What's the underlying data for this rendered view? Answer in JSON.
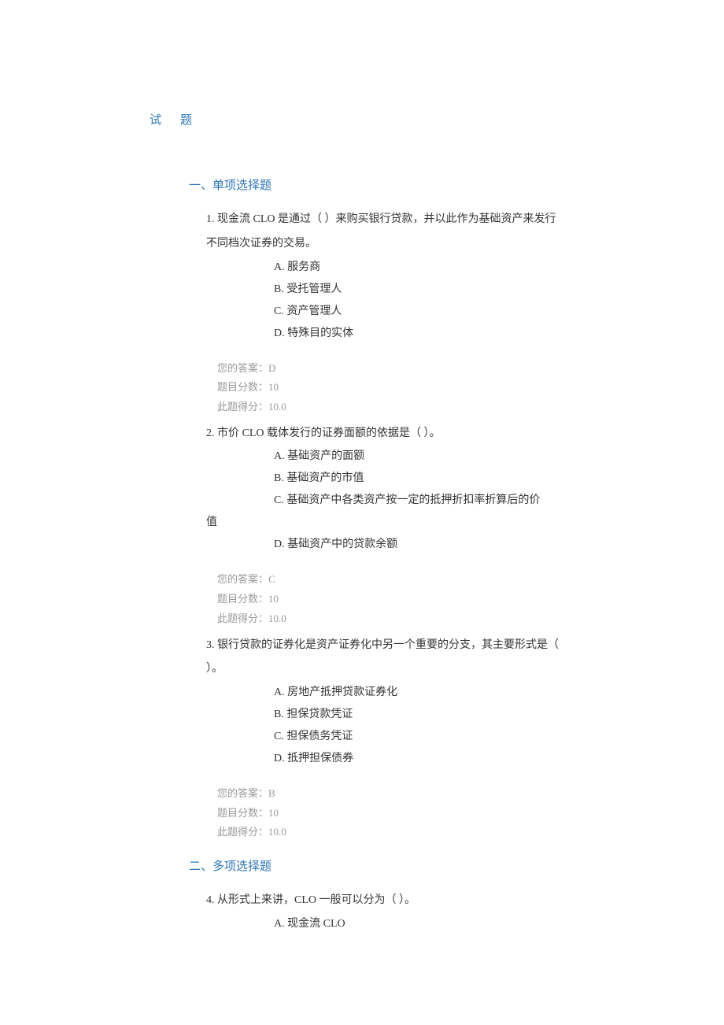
{
  "title": "试题",
  "section1": {
    "heading": "一、单项选择题",
    "questions": [
      {
        "stem": "1. 现金流 CLO 是通过（ ）来购买银行贷款，并以此作为基础资产来发行不同档次证券的交易。",
        "optA": "A. 服务商",
        "optB": "B. 受托管理人",
        "optC": "C. 资产管理人",
        "optD": "D. 特殊目的实体",
        "your_answer": "您的答案：D",
        "points": "题目分数：10",
        "score": "此题得分：10.0"
      },
      {
        "stem": "2. 市价 CLO 载体发行的证券面额的依据是（ ）。",
        "optA": "A. 基础资产的面额",
        "optB": "B. 基础资产的市值",
        "optC_pre": "C. 基础资产中各类资产按一定的抵押折扣率折算后的价",
        "optC_wrap": "值",
        "optD": "D. 基础资产中的贷款余额",
        "your_answer": "您的答案：C",
        "points": "题目分数：10",
        "score": "此题得分：10.0"
      },
      {
        "stem": "3. 银行贷款的证券化是资产证券化中另一个重要的分支，其主要形式是（ ）。",
        "optA": "A. 房地产抵押贷款证券化",
        "optB": "B. 担保贷款凭证",
        "optC": "C. 担保债务凭证",
        "optD": "D. 抵押担保债券",
        "your_answer": "您的答案：B",
        "points": "题目分数：10",
        "score": "此题得分：10.0"
      }
    ]
  },
  "section2": {
    "heading": "二、多项选择题",
    "questions": [
      {
        "stem": "4. 从形式上来讲，CLO 一般可以分为（ ）。",
        "optA": "A. 现金流 CLO"
      }
    ]
  }
}
